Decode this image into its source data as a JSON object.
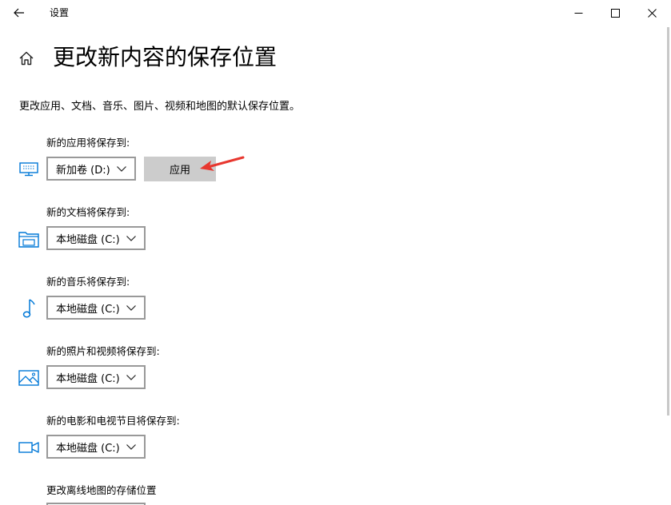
{
  "window": {
    "title": "设置",
    "controls": {
      "minimize": "minimize",
      "maximize": "maximize",
      "close": "close"
    }
  },
  "page": {
    "title": "更改新内容的保存位置",
    "description": "更改应用、文档、音乐、图片、视频和地图的默认保存位置。"
  },
  "sections": [
    {
      "label": "新的应用将保存到:",
      "icon": "monitor-icon",
      "selected": "新加卷 (D:)",
      "apply_label": "应用"
    },
    {
      "label": "新的文档将保存到:",
      "icon": "folder-drive-icon",
      "selected": "本地磁盘 (C:)"
    },
    {
      "label": "新的音乐将保存到:",
      "icon": "music-note-icon",
      "selected": "本地磁盘 (C:)"
    },
    {
      "label": "新的照片和视频将保存到:",
      "icon": "picture-icon",
      "selected": "本地磁盘 (C:)"
    },
    {
      "label": "新的电影和电视节目将保存到:",
      "icon": "video-camera-icon",
      "selected": "本地磁盘 (C:)"
    },
    {
      "label": "更改离线地图的存储位置"
    }
  ],
  "colors": {
    "accent": "#0078d7",
    "annotation_arrow": "#e8372f",
    "apply_button_bg": "#cccccc",
    "dropdown_border": "#999999"
  }
}
